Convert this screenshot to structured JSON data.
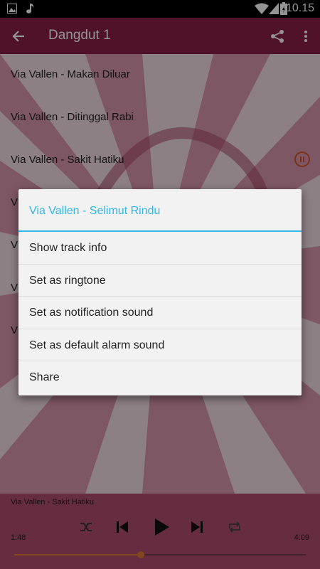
{
  "status_bar": {
    "time": "10.15",
    "icons": [
      "image-icon",
      "music-note-icon",
      "wifi-icon",
      "signal-icon",
      "battery-icon"
    ]
  },
  "toolbar": {
    "title": "Dangdut 1",
    "icons": [
      "back-arrow-icon",
      "share-icon",
      "overflow-menu-icon"
    ]
  },
  "tracks": [
    {
      "title": "Via Vallen - Makan Diluar"
    },
    {
      "title": "Via Vallen - Ditinggal Rabi"
    },
    {
      "title": "Via Vallen - Sakit Hatiku",
      "playing": true
    },
    {
      "title": "V"
    },
    {
      "title": "V"
    },
    {
      "title": "V"
    },
    {
      "title": "V"
    }
  ],
  "dialog": {
    "title": "Via Vallen - Selimut Rindu",
    "options": [
      "Show track info",
      "Set as ringtone",
      "Set as notification sound",
      "Set as default alarm sound",
      "Share"
    ]
  },
  "player": {
    "now_playing": "Via Vallen - Sakit Hatiku",
    "elapsed": "1:48",
    "duration": "4:09",
    "progress": 0.434
  },
  "colors": {
    "toolbar": "#8a1f45",
    "accent": "#33b5e5",
    "pause": "#d7542a",
    "seek": "#e07a2e"
  }
}
